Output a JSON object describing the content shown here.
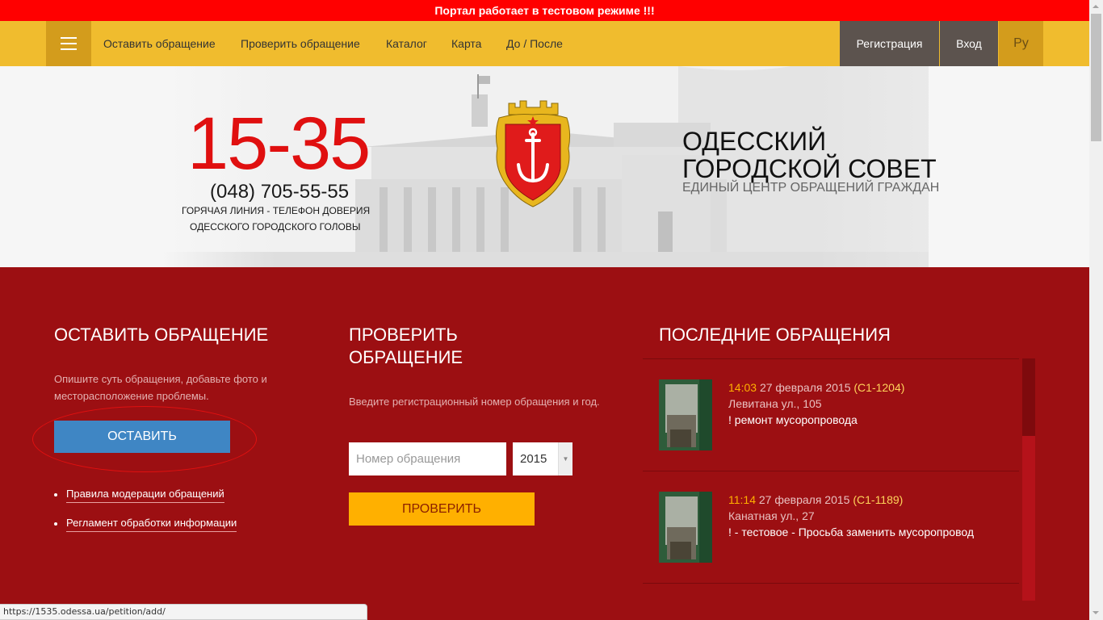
{
  "banner": {
    "text": "Портал работает в тестовом режиме !!!"
  },
  "nav": {
    "menu_icon": "hamburger-icon",
    "links": [
      "Оставить обращение",
      "Проверить обращение",
      "Каталог",
      "Карта",
      "До / После"
    ],
    "register_label": "Регистрация",
    "login_label": "Вход",
    "lang_label": "Ру"
  },
  "hero": {
    "hotline_number": "15-35",
    "phone": "(048) 705-55-55",
    "hotline_line1": "ГОРЯЧАЯ ЛИНИЯ - ТЕЛЕФОН ДОВЕРИЯ",
    "hotline_line2": "ОДЕССКОГО ГОРОДСКОГО ГОЛОВЫ",
    "council_title": "ОДЕССКИЙ ГОРОДСКОЙ СОВЕТ",
    "council_subtitle": "ЕДИНЫЙ ЦЕНТР ОБРАЩЕНИЙ ГРАЖДАН",
    "coat_icon": "odessa-coat-of-arms-icon"
  },
  "leave": {
    "title": "ОСТАВИТЬ ОБРАЩЕНИЕ",
    "description": "Опишите суть обращения, добавьте фото и месторасположение проблемы.",
    "button_label": "ОСТАВИТЬ",
    "links": [
      "Правила модерации обращений",
      "Регламент обработки информации"
    ]
  },
  "check": {
    "title": "ПРОВЕРИТЬ ОБРАЩЕНИЕ",
    "description": "Введите регистрационный номер обращения и год.",
    "input_placeholder": "Номер обращения",
    "year_value": "2015",
    "button_label": "ПРОВЕРИТЬ"
  },
  "latest": {
    "title": "ПОСЛЕДНИЕ ОБРАЩЕНИЯ",
    "items": [
      {
        "time": "14:03",
        "date": "27 февраля 2015",
        "code": "(С1-1204)",
        "address": "Левитана ул., 105",
        "text": "! ремонт мусоропровода"
      },
      {
        "time": "11:14",
        "date": "27 февраля 2015",
        "code": "(С1-1189)",
        "address": "Канатная ул., 27",
        "text": "! - тестовое - Просьба заменить мусоропровод"
      }
    ]
  },
  "status_bar": {
    "url": "https://1535.odessa.ua/petition/add/"
  },
  "colors": {
    "banner": "#ff0000",
    "nav": "#f0bc2e",
    "accent_dark": "#d39c1c",
    "main_bg": "#9c0f12",
    "leave_button": "#3f86c4",
    "check_button": "#ffb000"
  }
}
